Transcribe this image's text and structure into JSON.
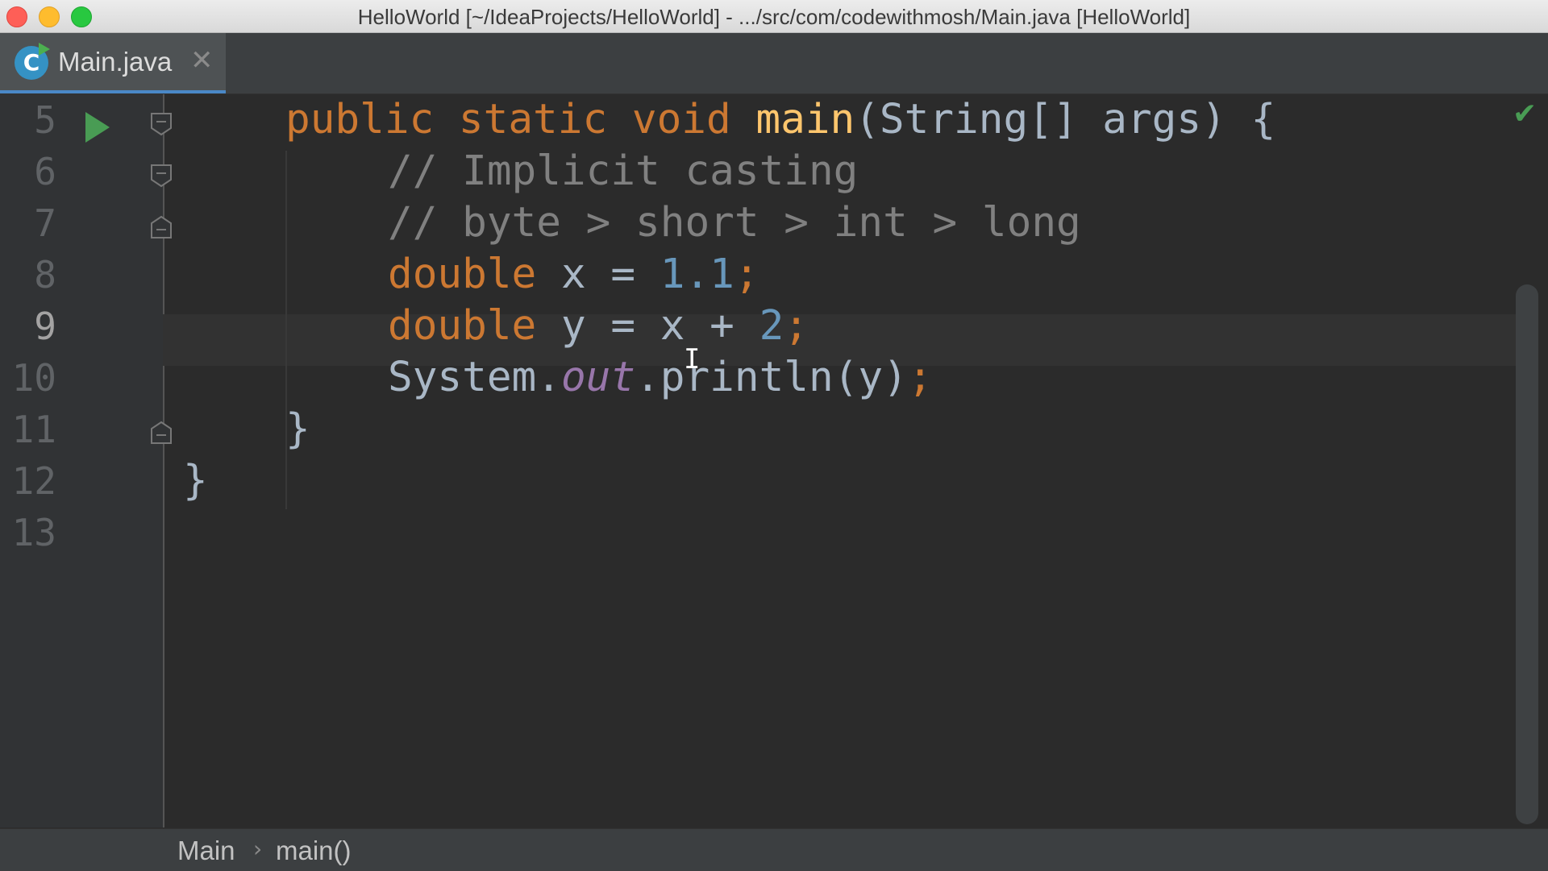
{
  "window": {
    "title": "HelloWorld [~/IdeaProjects/HelloWorld] - .../src/com/codewithmosh/Main.java [HelloWorld]"
  },
  "tabs": [
    {
      "label": "Main.java",
      "icon": "java-class-icon",
      "active": true
    }
  ],
  "editor": {
    "current_line": 9,
    "lines": [
      {
        "number": "5",
        "tokens": [
          [
            "kw",
            "public static void "
          ],
          [
            "fn",
            "main"
          ],
          [
            "txt",
            "(String[] args) {"
          ]
        ]
      },
      {
        "number": "6",
        "tokens": [
          [
            "cm",
            "// Implicit casting"
          ]
        ]
      },
      {
        "number": "7",
        "tokens": [
          [
            "cm",
            "// byte > short > int > long"
          ]
        ]
      },
      {
        "number": "8",
        "tokens": [
          [
            "kw",
            "double "
          ],
          [
            "txt",
            "x = "
          ],
          [
            "num",
            "1.1"
          ],
          [
            "kw",
            ";"
          ]
        ]
      },
      {
        "number": "9",
        "tokens": [
          [
            "kw",
            "double "
          ],
          [
            "txt",
            "y = x + "
          ],
          [
            "num",
            "2"
          ],
          [
            "kw",
            ";"
          ]
        ]
      },
      {
        "number": "10",
        "tokens": [
          [
            "txt",
            "System."
          ],
          [
            "fld",
            "out"
          ],
          [
            "txt",
            ".println(y)"
          ],
          [
            "kw",
            ";"
          ]
        ]
      },
      {
        "number": "11",
        "tokens": [
          [
            "txt",
            "}"
          ]
        ]
      },
      {
        "number": "12",
        "tokens": [
          [
            "txt",
            "}"
          ]
        ]
      },
      {
        "number": "13",
        "tokens": []
      }
    ]
  },
  "breadcrumb": {
    "items": [
      "Main",
      "main()"
    ],
    "separator": "›"
  },
  "colors": {
    "keyword": "#cc7832",
    "function": "#ffc66d",
    "number": "#6897bb",
    "comment": "#808080",
    "field": "#9876aa",
    "text": "#a9b7c6"
  }
}
